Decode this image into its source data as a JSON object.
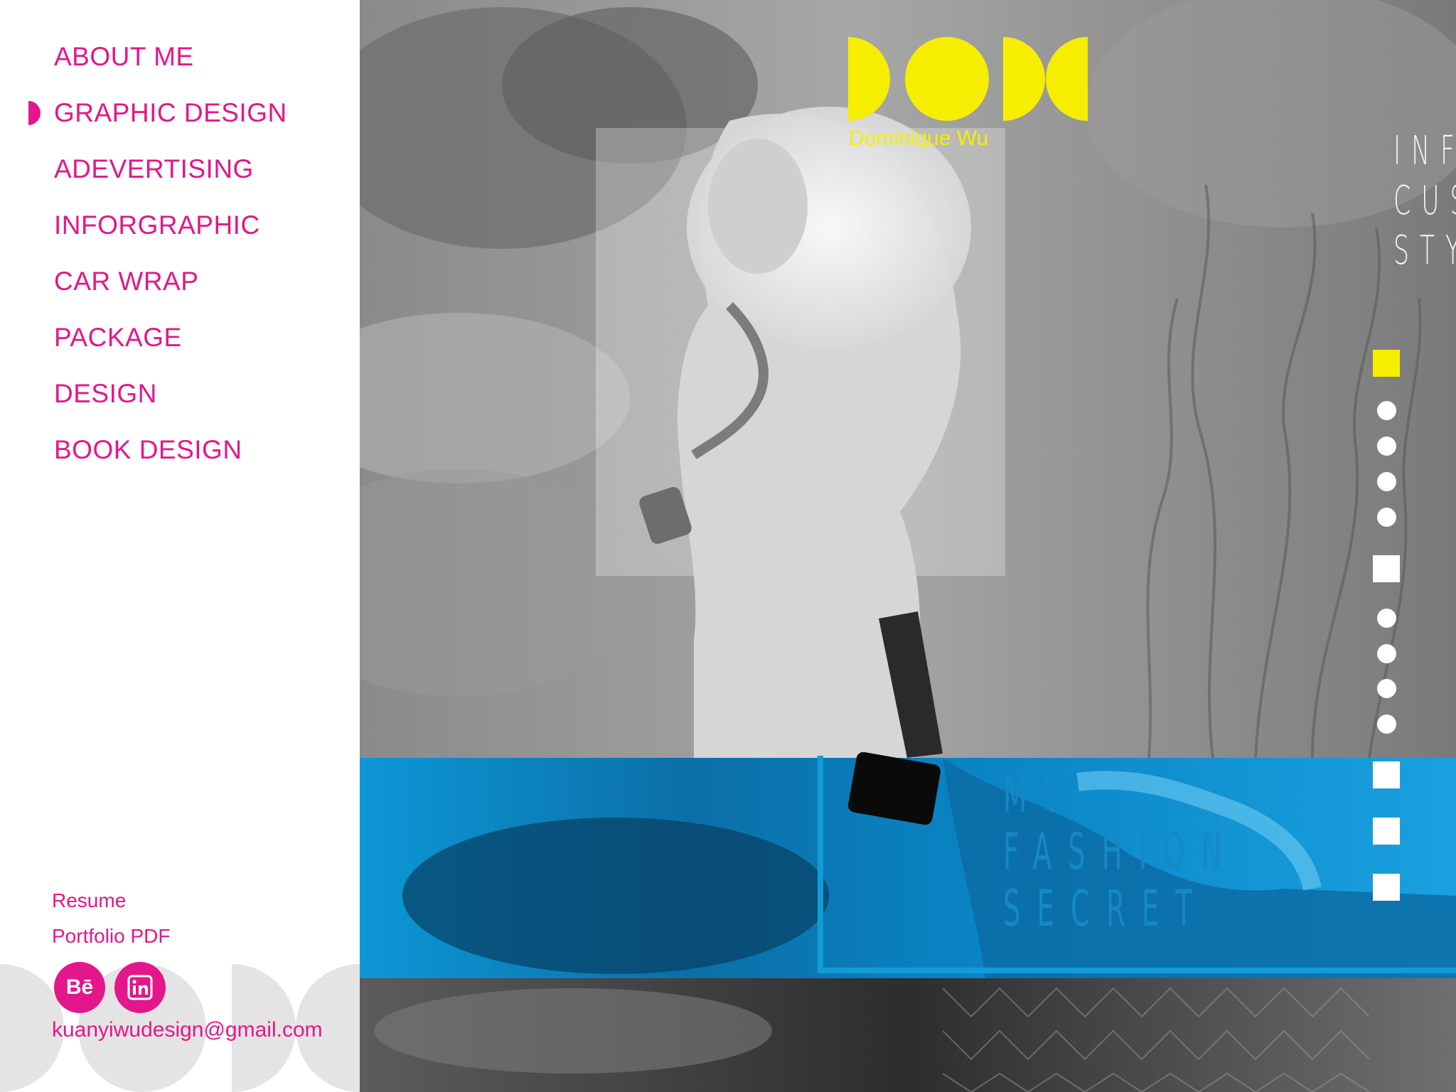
{
  "nav": {
    "items": [
      {
        "label": "ABOUT ME",
        "active": false
      },
      {
        "label": "GRAPHIC DESIGN",
        "active": true
      },
      {
        "label": "ADEVERTISING",
        "active": false
      },
      {
        "label": "INFORGRAPHIC",
        "active": false
      },
      {
        "label": "CAR WRAP",
        "active": false
      },
      {
        "label": "PACKAGE",
        "active": false
      },
      {
        "label": "DESIGN",
        "active": false
      },
      {
        "label": "BOOK DESIGN",
        "active": false
      }
    ]
  },
  "sidebar_footer": {
    "resume_label": "Resume",
    "portfolio_label": "Portfolio PDF",
    "behance_label": "Bē",
    "linkedin_icon": "linkedin-icon",
    "email": "kuanyiwudesign@gmail.com"
  },
  "brand": {
    "name": "Dominique Wu",
    "logo_color": "#f6ee00"
  },
  "hero": {
    "tagline_lines": [
      "INFINITE",
      "CUSTOM",
      "STYLES"
    ],
    "badge_icon": "infinity-icon",
    "fashion_lines": [
      "MY",
      "FASHION",
      "SECRET"
    ]
  },
  "pager": {
    "items": [
      "square",
      "dot",
      "dot",
      "dot",
      "dot",
      "square",
      "dot",
      "dot",
      "dot",
      "dot",
      "square",
      "square",
      "square"
    ],
    "active_index": 0
  },
  "colors": {
    "accent": "#e4168b",
    "brand_yellow": "#f6ee00",
    "band_blue": "#139bd8"
  }
}
